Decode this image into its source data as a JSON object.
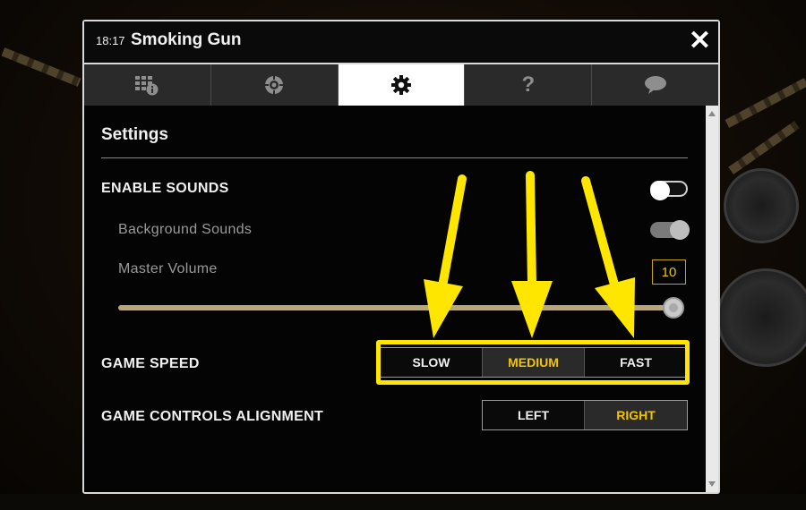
{
  "window": {
    "time": "18:17",
    "title": "Smoking Gun",
    "close_label": "✕"
  },
  "tabs": [
    {
      "id": "paytable",
      "icon": "paytable-info-icon"
    },
    {
      "id": "game-rules",
      "icon": "chip-icon"
    },
    {
      "id": "settings",
      "icon": "gear-icon",
      "active": true
    },
    {
      "id": "help",
      "icon": "question-icon"
    },
    {
      "id": "chat",
      "icon": "chat-bubble-icon"
    }
  ],
  "settings": {
    "heading": "Settings",
    "enable_sounds": {
      "label": "ENABLE SOUNDS",
      "on": false
    },
    "background_sounds": {
      "label": "Background Sounds",
      "on": true
    },
    "master_volume": {
      "label": "Master Volume",
      "value": "10",
      "level": 1.0
    },
    "game_speed": {
      "label": "GAME SPEED",
      "options": [
        "SLOW",
        "MEDIUM",
        "FAST"
      ],
      "selected": "MEDIUM"
    },
    "controls_alignment": {
      "label": "GAME CONTROLS ALIGNMENT",
      "options": [
        "LEFT",
        "RIGHT"
      ],
      "selected": "RIGHT"
    }
  },
  "colors": {
    "accent": "#f2c400",
    "annotation": "#ffe600",
    "panel": "#111111"
  }
}
